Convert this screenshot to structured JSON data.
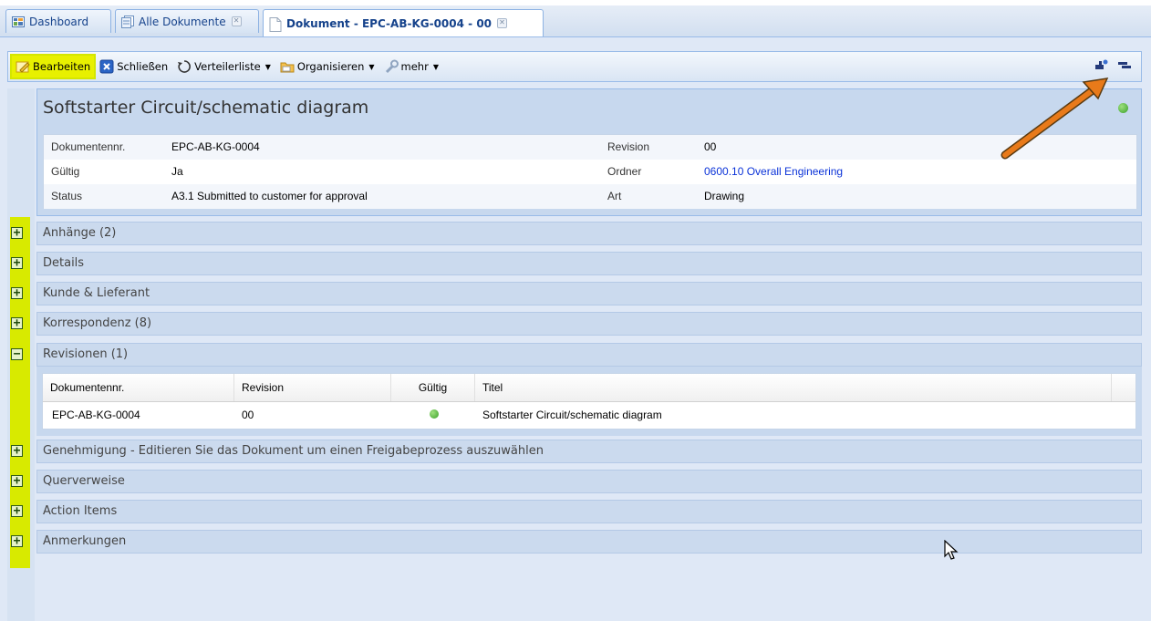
{
  "tabs": [
    {
      "label": "Dashboard",
      "icon": "dashboard-icon",
      "closable": false,
      "active": false
    },
    {
      "label": "Alle Dokumente",
      "icon": "documents-icon",
      "closable": true,
      "active": false
    },
    {
      "label": "Dokument - EPC-AB-KG-0004 - 00",
      "icon": "document-icon",
      "closable": true,
      "active": true
    }
  ],
  "toolbar": {
    "edit": "Bearbeiten",
    "close": "Schließen",
    "distribution": "Verteilerliste",
    "organize": "Organisieren",
    "more": "mehr",
    "right_icons": [
      "add-user-icon",
      "collapse-panel-icon"
    ]
  },
  "document": {
    "title": "Softstarter Circuit/schematic diagram",
    "status_color": "#3aa12a",
    "fields": {
      "docnr_label": "Dokumentennr.",
      "docnr_value": "EPC-AB-KG-0004",
      "valid_label": "Gültig",
      "valid_value": "Ja",
      "status_label": "Status",
      "status_value": "A3.1 Submitted to customer for approval",
      "revision_label": "Revision",
      "revision_value": "00",
      "folder_label": "Ordner",
      "folder_value": "0600.10 Overall Engineering",
      "type_label": "Art",
      "type_value": "Drawing"
    }
  },
  "sections": [
    {
      "label": "Anhänge (2)",
      "expanded": false
    },
    {
      "label": "Details",
      "expanded": false
    },
    {
      "label": "Kunde & Lieferant",
      "expanded": false
    },
    {
      "label": "Korrespondenz (8)",
      "expanded": false
    },
    {
      "label": "Revisionen (1)",
      "expanded": true
    },
    {
      "label": "Genehmigung - Editieren Sie das Dokument um einen Freigabeprozess auszuwählen",
      "expanded": false
    },
    {
      "label": "Querverweise",
      "expanded": false
    },
    {
      "label": "Action Items",
      "expanded": false
    },
    {
      "label": "Anmerkungen",
      "expanded": false
    }
  ],
  "revisions": {
    "columns": [
      "Dokumentennr.",
      "Revision",
      "Gültig",
      "Titel"
    ],
    "rows": [
      {
        "docnr": "EPC-AB-KG-0004",
        "revision": "00",
        "valid": true,
        "title": "Softstarter Circuit/schematic diagram"
      }
    ]
  },
  "colors": {
    "highlight": "#e8f000",
    "accent": "#15428b",
    "annotation_arrow": "#e87a1a"
  }
}
